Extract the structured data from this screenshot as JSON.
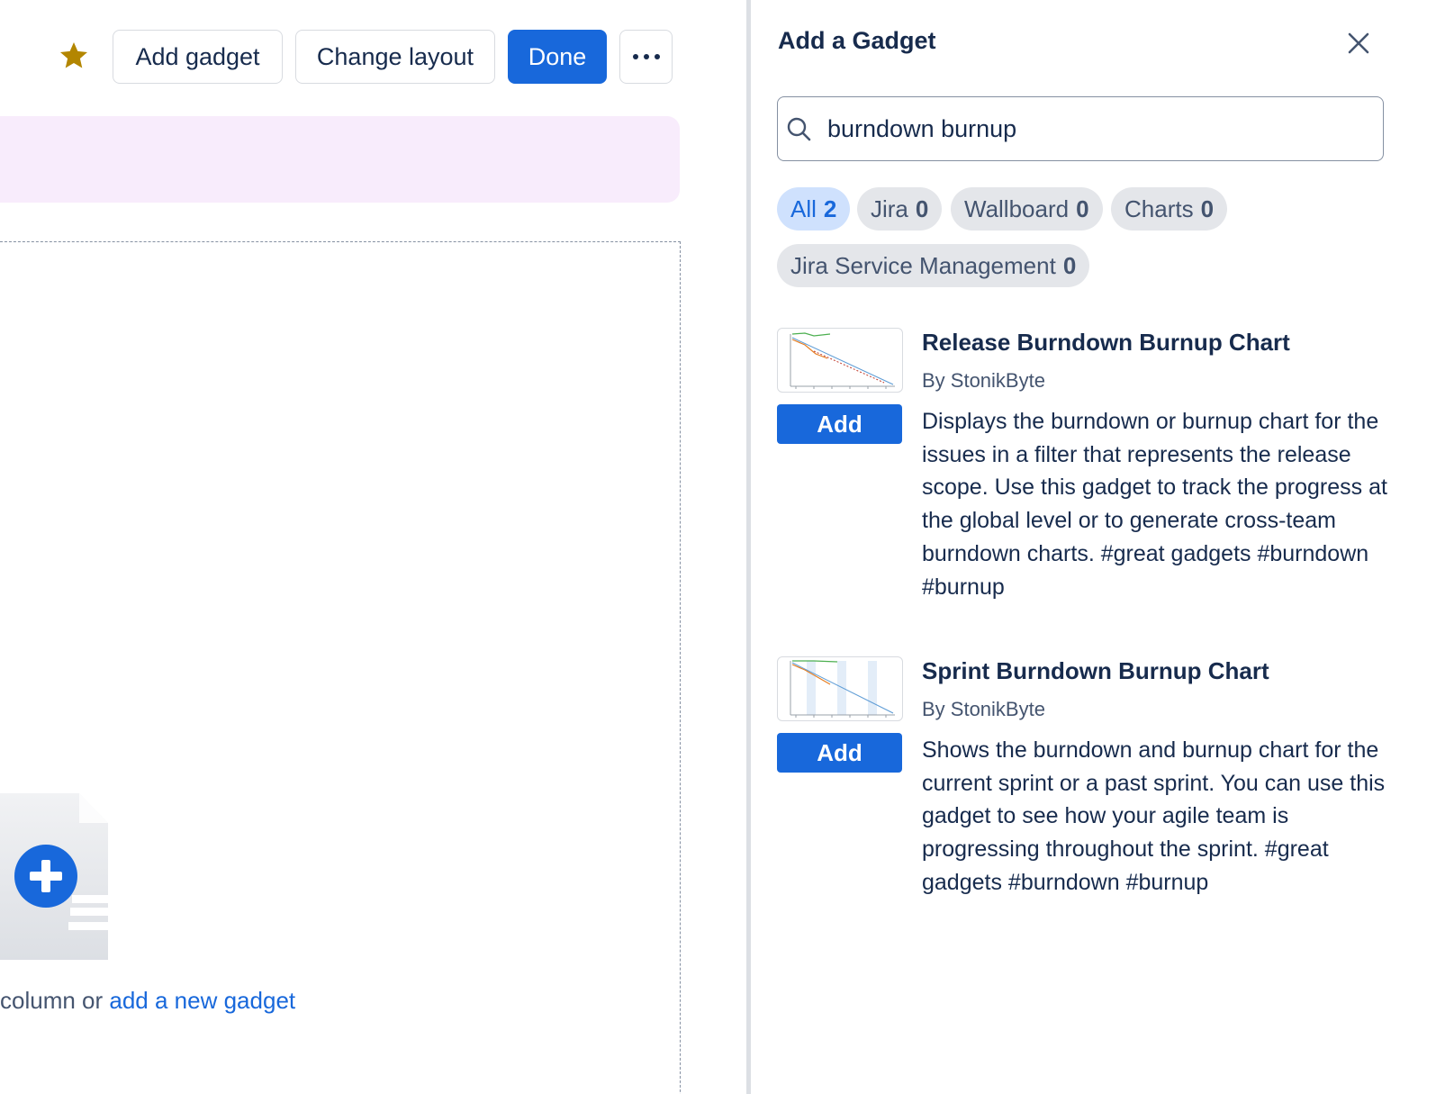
{
  "toolbar": {
    "add_gadget_label": "Add gadget",
    "change_layout_label": "Change layout",
    "done_label": "Done",
    "more_label": "···"
  },
  "dashboard": {
    "empty_text_prefix": "column or ",
    "empty_link": "add a new gadget"
  },
  "panel": {
    "title": "Add a Gadget",
    "search": {
      "value": "burndown burnup",
      "placeholder": ""
    },
    "filters": [
      {
        "label": "All",
        "count": "2",
        "active": true
      },
      {
        "label": "Jira",
        "count": "0",
        "active": false
      },
      {
        "label": "Wallboard",
        "count": "0",
        "active": false
      },
      {
        "label": "Charts",
        "count": "0",
        "active": false
      },
      {
        "label": "Jira Service Management",
        "count": "0",
        "active": false
      }
    ],
    "gadgets": [
      {
        "title": "Release Burndown Burnup Chart",
        "author": "By StonikByte",
        "add_label": "Add",
        "description": "Displays the burndown or burnup chart for the issues in a filter that represents the release scope. Use this gadget to track the progress at the global level or to generate cross-team burndown charts. #great gadgets #burndown #burnup"
      },
      {
        "title": "Sprint Burndown Burnup Chart",
        "author": "By StonikByte",
        "add_label": "Add",
        "description": "Shows the burndown and burnup chart for the current sprint or a past sprint. You can use this gadget to see how your agile team is progressing throughout the sprint. #great gadgets #burndown #burnup"
      }
    ]
  },
  "colors": {
    "primary": "#1868db",
    "star": "#b38600",
    "banner": "#f8ecfc",
    "chip_active_bg": "#cfe1fd",
    "chip_bg": "#e4e6ea"
  }
}
